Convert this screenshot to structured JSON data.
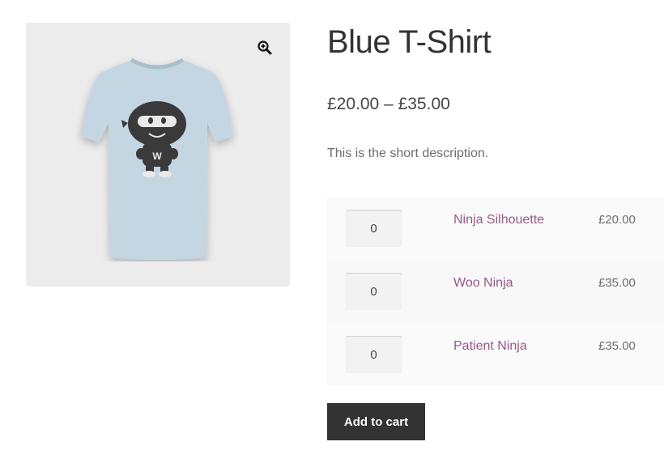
{
  "product": {
    "title": "Blue T-Shirt",
    "price_range": "£20.00 – £35.00",
    "short_description": "This is the short description.",
    "image_icon": "zoom-in-icon",
    "shirt_color": "#c3d6e2",
    "logo_letter": "W"
  },
  "grouped_items": [
    {
      "quantity": "0",
      "name": "Ninja Silhouette",
      "price": "£20.00"
    },
    {
      "quantity": "0",
      "name": "Woo Ninja",
      "price": "£35.00"
    },
    {
      "quantity": "0",
      "name": "Patient Ninja",
      "price": "£35.00"
    }
  ],
  "actions": {
    "add_to_cart_label": "Add to cart"
  },
  "colors": {
    "link": "#96588a",
    "button_bg": "#333333",
    "gallery_bg": "#ececec"
  }
}
